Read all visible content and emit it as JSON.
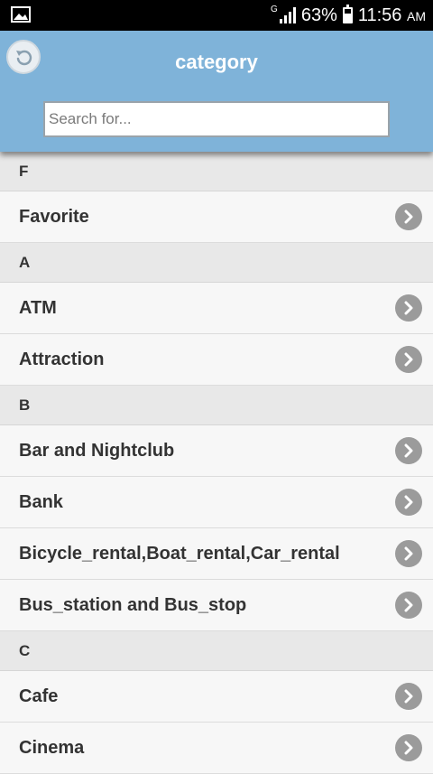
{
  "status_bar": {
    "network_type": "G",
    "battery_percent": "63%",
    "battery_level": 0.63,
    "time": "11:56",
    "ampm": "AM",
    "left_icon": "image-icon"
  },
  "header": {
    "title": "category",
    "back_icon": "back-icon",
    "background_color": "#7fb3d9"
  },
  "search": {
    "placeholder": "Search for...",
    "value": ""
  },
  "sections": [
    {
      "letter": "F",
      "items": [
        "Favorite"
      ]
    },
    {
      "letter": "A",
      "items": [
        "ATM",
        "Attraction"
      ]
    },
    {
      "letter": "B",
      "items": [
        "Bar and Nightclub",
        "Bank",
        "Bicycle_rental,Boat_rental,Car_rental",
        "Bus_station and Bus_stop"
      ]
    },
    {
      "letter": "C",
      "items": [
        "Cafe",
        "Cinema"
      ]
    }
  ],
  "item_icon": "chevron-right-icon"
}
